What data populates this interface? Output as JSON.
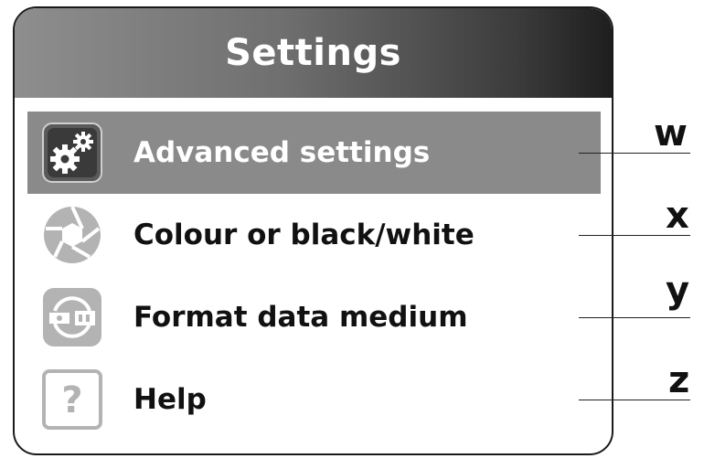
{
  "header": {
    "title": "Settings"
  },
  "menu": {
    "items": [
      {
        "label": "Advanced settings",
        "icon": "gears-icon",
        "selected": true
      },
      {
        "label": "Colour or black/white",
        "icon": "aperture-icon",
        "selected": false
      },
      {
        "label": "Format data medium",
        "icon": "format-media-icon",
        "selected": false
      },
      {
        "label": "Help",
        "icon": "help-icon",
        "selected": false
      }
    ]
  },
  "callouts": [
    "w",
    "x",
    "y",
    "z"
  ],
  "colors": {
    "selected_background": "#8a8a8a",
    "icon_gray": "#b3b3b3",
    "text": "#111111"
  }
}
